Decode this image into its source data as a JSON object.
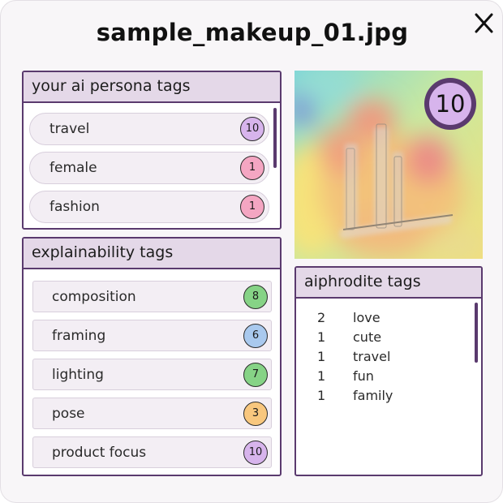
{
  "title": "sample_makeup_01.jpg",
  "close_icon": "close-icon",
  "persona": {
    "header": "your ai persona tags",
    "tags": [
      {
        "label": "travel",
        "count": "10",
        "color": "#d7b4ec"
      },
      {
        "label": "female",
        "count": "1",
        "color": "#f4a6c2"
      },
      {
        "label": "fashion",
        "count": "1",
        "color": "#f4a6c2"
      }
    ]
  },
  "explain": {
    "header": "explainability tags",
    "tags": [
      {
        "label": "composition",
        "count": "8",
        "color": "#86d386"
      },
      {
        "label": "framing",
        "count": "6",
        "color": "#a9c9ee"
      },
      {
        "label": "lighting",
        "count": "7",
        "color": "#86d386"
      },
      {
        "label": "pose",
        "count": "3",
        "color": "#f8c77e"
      },
      {
        "label": "product focus",
        "count": "10",
        "color": "#d7b4ec"
      }
    ]
  },
  "image": {
    "score": "10",
    "description_icon": "heatmap-image"
  },
  "aiphrodite": {
    "header": "aiphrodite tags",
    "tags": [
      {
        "count": "2",
        "label": "love"
      },
      {
        "count": "1",
        "label": "cute"
      },
      {
        "count": "1",
        "label": "travel"
      },
      {
        "count": "1",
        "label": "fun"
      },
      {
        "count": "1",
        "label": "family"
      }
    ]
  },
  "colors": {
    "accent": "#5a3a6e",
    "header_bg": "#e4d8e8",
    "row_bg": "#f3eef4"
  }
}
